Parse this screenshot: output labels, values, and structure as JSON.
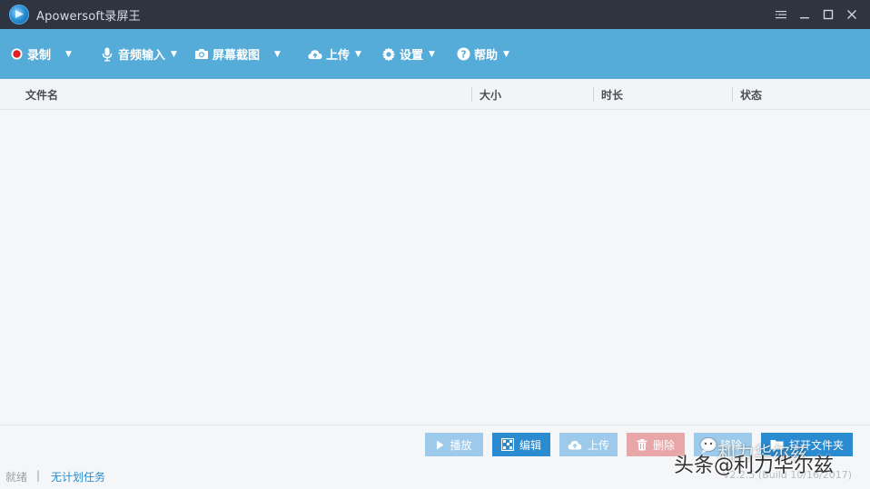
{
  "window": {
    "title": "Apowersoft录屏王"
  },
  "toolbar": {
    "record_label": "录制",
    "audio_input_label": "音频输入",
    "screenshot_label": "屏幕截图",
    "upload_label": "上传",
    "settings_label": "设置",
    "help_label": "帮助"
  },
  "table": {
    "columns": [
      "文件名",
      "大小",
      "时长",
      "状态"
    ],
    "rows": []
  },
  "actions": {
    "play_label": "播放",
    "edit_label": "编辑",
    "upload_label": "上传",
    "delete_label": "删除",
    "remove_label": "移除",
    "open_folder_label": "打开文件夹"
  },
  "status_bar": {
    "ready": "就绪",
    "separator": "|",
    "no_scheduled_task": "无计划任务",
    "version": "V2.2.5 (Build 10/16/2017)"
  },
  "watermark": {
    "line1": "利力华尔兹",
    "line2": "头条@利力华尔兹"
  },
  "colors": {
    "titlebar": "#2e3540",
    "toolbar": "#55acd9",
    "accent": "#2a8bd0",
    "record_red": "#e02020",
    "delete": "#e8a6a8"
  }
}
